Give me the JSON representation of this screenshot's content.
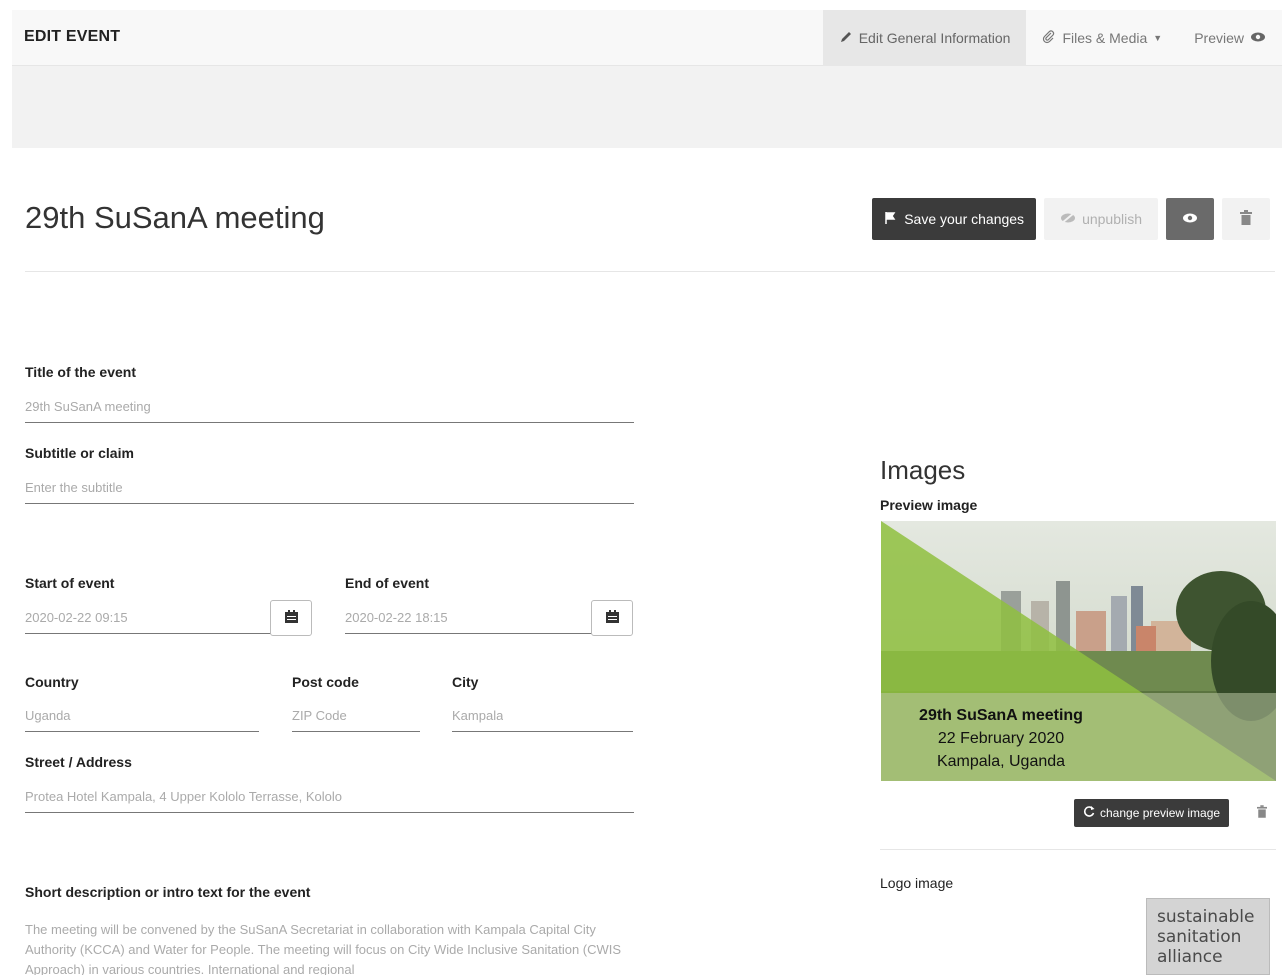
{
  "header": {
    "title": "EDIT EVENT",
    "nav": [
      {
        "label": "Edit General Information",
        "icon": "pencil-icon",
        "active": true
      },
      {
        "label": "Files & Media",
        "icon": "paperclip-icon",
        "dropdown": true
      },
      {
        "label": "Preview",
        "icon": "eye-icon"
      }
    ]
  },
  "page": {
    "title": "29th SuSanA meeting",
    "actions": {
      "save_label": "Save your changes",
      "unpublish_label": "unpublish"
    }
  },
  "form": {
    "title": {
      "label": "Title of the event",
      "value": "29th SuSanA meeting"
    },
    "subtitle": {
      "label": "Subtitle or claim",
      "placeholder": "Enter the subtitle"
    },
    "start": {
      "label": "Start of event",
      "value": "2020-02-22 09:15"
    },
    "end": {
      "label": "End of event",
      "value": "2020-02-22 18:15"
    },
    "country": {
      "label": "Country",
      "value": "Uganda"
    },
    "postcode": {
      "label": "Post code",
      "placeholder": "ZIP Code"
    },
    "city": {
      "label": "City",
      "value": "Kampala"
    },
    "street": {
      "label": "Street / Address",
      "value": "Protea Hotel Kampala, 4 Upper Kololo Terrasse, Kololo"
    },
    "description": {
      "label": "Short description or intro text for the event",
      "value": "The meeting will be convened by the SuSanA Secretariat in collaboration with Kampala Capital City Authority (KCCA) and Water for People. The meeting will focus on City Wide Inclusive Sanitation (CWIS Approach) in various countries. International and regional"
    }
  },
  "images": {
    "heading": "Images",
    "preview_label": "Preview image",
    "preview_caption": [
      "29th SuSanA meeting",
      "22 February 2020",
      "Kampala, Uganda"
    ],
    "change_label": "change preview image",
    "logo_label": "Logo image",
    "logo_text": [
      "sustainable",
      "sanitation",
      "alliance"
    ]
  },
  "colors": {
    "dark_button": "#3b3b3b",
    "green_overlay": "#8fbf3f"
  }
}
